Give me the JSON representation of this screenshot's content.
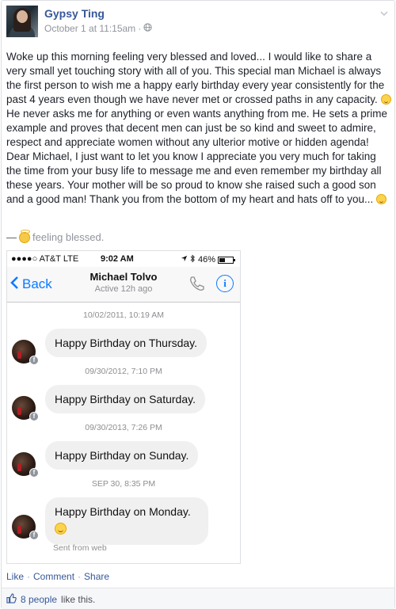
{
  "post": {
    "author": "Gypsy Ting",
    "timestamp": "October 1 at 11:15am",
    "privacy_icon": "globe-icon",
    "body": "Woke up this morning feeling very blessed and loved... I would like to share a very small yet touching story with all of you. This special man Michael is always the first person to wish me a happy early birthday every year consistently for the past 4 years even though we have never met or crossed paths in any capacity.",
    "body_part2": " He never asks me for anything or even wants anything from me. He sets a prime example and proves that decent men can just be so kind and sweet to admire, respect and appreciate women without any ulterior motive or hidden agenda! Dear Michael, I just want to let you know I appreciate you very much for taking the time from your busy life to message me and even remember my birthday all these years. Your mother will be so proud to know she raised such a good son and a good man! Thank you from the bottom of my heart and hats off to you...",
    "feeling_dash": "—",
    "feeling": "feeling blessed."
  },
  "phone": {
    "status": {
      "carrier": "●●●●○ AT&T  LTE",
      "time": "9:02 AM",
      "battery": "46%",
      "battery_level": 0.46
    },
    "nav": {
      "back_label": "Back",
      "contact_name": "Michael Tolvo",
      "active_status": "Active 12h ago",
      "info_glyph": "i"
    },
    "messages": [
      {
        "stamp": "10/02/2011, 10:19 AM",
        "text": "Happy Birthday on Thursday."
      },
      {
        "stamp": "09/30/2012, 7:10 PM",
        "text": "Happy Birthday on Saturday."
      },
      {
        "stamp": "09/30/2013, 7:26 PM",
        "text": "Happy Birthday on Sunday."
      },
      {
        "stamp": "SEP 30, 8:35 PM",
        "text": "Happy Birthday on Monday."
      }
    ],
    "sent_from": "Sent from web"
  },
  "actions": {
    "like": "Like",
    "comment": "Comment",
    "share": "Share",
    "separator": "·"
  },
  "likes": {
    "count": "8 people",
    "rest": "like this."
  }
}
